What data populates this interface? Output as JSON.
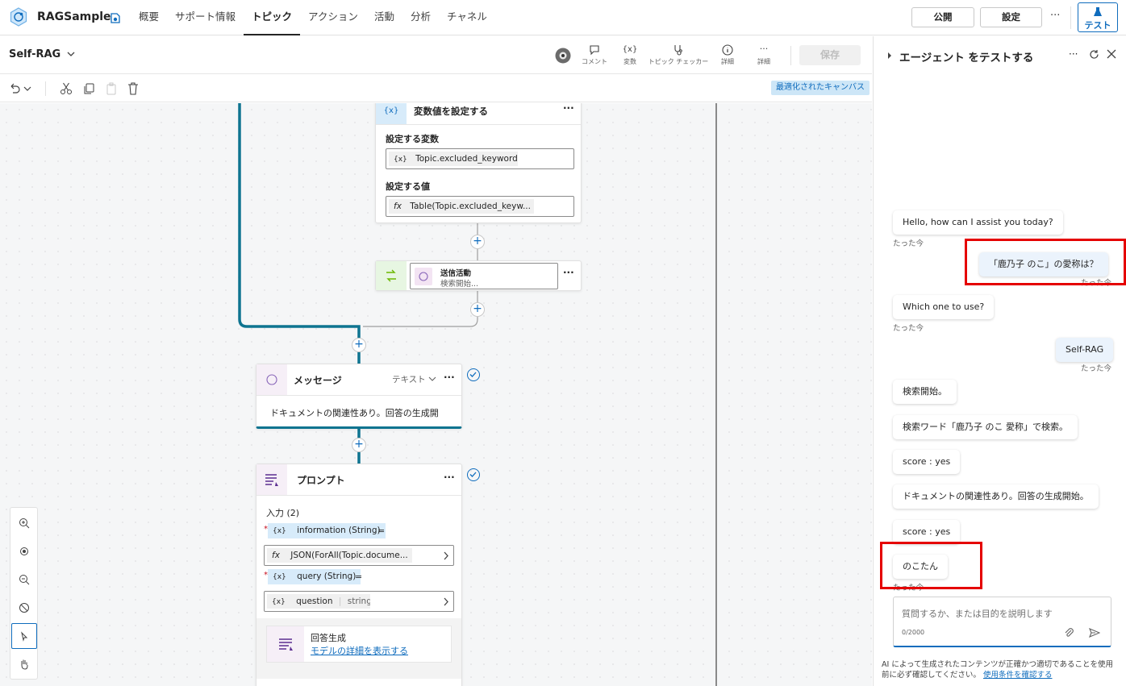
{
  "app": {
    "title": "RAGSample"
  },
  "nav": {
    "items": [
      "概要",
      "サポート情報",
      "トピック",
      "アクション",
      "活動",
      "分析",
      "チャネル"
    ],
    "active": "トピック"
  },
  "header_buttons": {
    "publish": "公開",
    "settings": "設定",
    "more": "···",
    "test": "テスト"
  },
  "topic": {
    "name": "Self-RAG"
  },
  "tools": {
    "comment": "コメント",
    "variables": "変数",
    "checker": "トピック チェッカー",
    "details": "詳細",
    "more": "詳細",
    "save": "保存"
  },
  "edit": {
    "canvas_badge": "最適化されたキャンバス"
  },
  "set_var_node": {
    "title": "変数値を設定する",
    "var_label": "設定する変数",
    "var_value": "Topic.excluded_keywords",
    "value_label": "設定する値",
    "value_value": "Table(Topic.excluded_keyw..."
  },
  "send_node": {
    "title": "送信活動",
    "subtitle": "検索開始..."
  },
  "message_node": {
    "title": "メッセージ",
    "type": "テキスト",
    "text": "ドキュメントの関連性あり。回答の生成開"
  },
  "prompt_node": {
    "title": "プロンプト",
    "inputs_label": "入力 (2)",
    "input1_name": "information (String)",
    "input1_value": "JSON(ForAll(Topic.docume...",
    "input2_name": "query (String)",
    "input2_value": "question",
    "input2_type": "string",
    "sub_title": "回答生成",
    "sub_link": "モデルの詳細を表示する"
  },
  "icons": {
    "variable": "{x}",
    "formula": "fx"
  },
  "test_panel": {
    "title": "エージェント をテストする",
    "messages": [
      {
        "role": "bot",
        "text": "Hello, how can I assist you today?",
        "time": "たった今"
      },
      {
        "role": "user",
        "text": "「鹿乃子 のこ」の愛称は？",
        "time": "たった今"
      },
      {
        "role": "bot",
        "text": "Which one to use?",
        "time": "たった今"
      },
      {
        "role": "user",
        "text": "Self-RAG",
        "time": "たった今"
      },
      {
        "role": "bot",
        "text": "検索開始。"
      },
      {
        "role": "bot",
        "text": "検索ワード「鹿乃子 のこ 愛称」で検索。"
      },
      {
        "role": "bot",
        "text": "score : yes"
      },
      {
        "role": "bot",
        "text": "ドキュメントの関連性あり。回答の生成開始。"
      },
      {
        "role": "bot",
        "text": "score : yes"
      },
      {
        "role": "bot",
        "text": "のこたん",
        "time": "たった今"
      }
    ],
    "input_placeholder": "質問するか、または目的を説明します",
    "char_count": "0/2000",
    "disclaimer": "AI によって生成されたコンテンツが正確かつ適切であることを使用前に必ず確認してください。",
    "terms_link": "使用条件を確認する"
  },
  "colors": {
    "accent": "#0f6cbd",
    "flow_line": "#0e7490",
    "highlight": "#e50000"
  }
}
